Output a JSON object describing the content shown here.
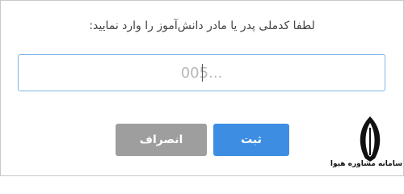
{
  "dialog": {
    "prompt": "لطفا کدملی پدر یا مادر دانش‌آموز را وارد نمایید:",
    "input": {
      "value": "",
      "placeholder": "005..."
    },
    "buttons": {
      "submit_label": "ثبت",
      "cancel_label": "انصراف"
    }
  },
  "watermark": {
    "text": "سامانه مشاوره هیوا",
    "icon": "feather-nib-icon"
  },
  "colors": {
    "accent": "#3d8ee3",
    "cancel": "#9e9e9e",
    "input_border": "#7fb6e8"
  }
}
